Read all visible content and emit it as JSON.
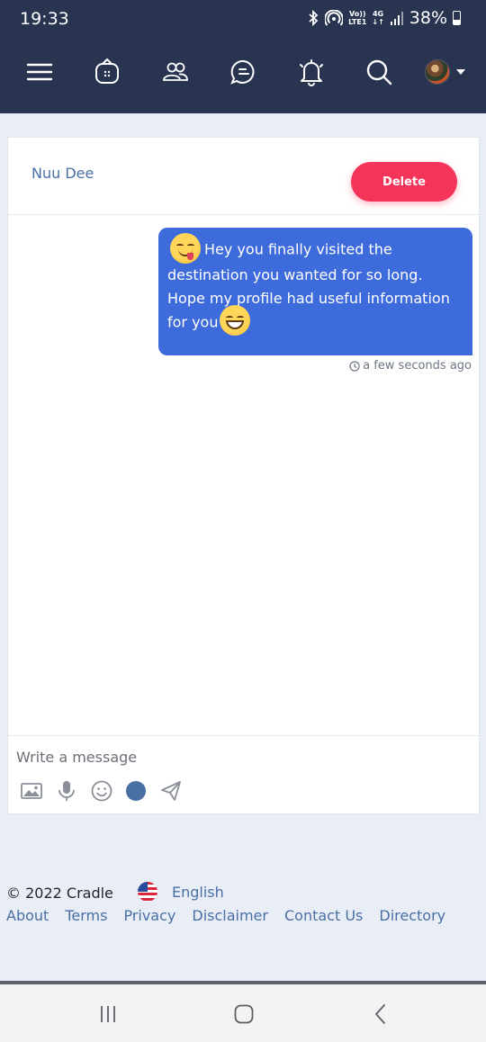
{
  "status_bar": {
    "time": "19:33",
    "volte_top": "Vo))",
    "volte_bottom": "LTE1",
    "network_top": "4G",
    "network_bottom": "↓↑",
    "battery_pct": "38%"
  },
  "nav": {
    "icons": [
      "menu-icon",
      "home-icon",
      "friends-icon",
      "messages-icon",
      "notifications-icon",
      "search-icon",
      "avatar",
      "caret-down-icon"
    ]
  },
  "chat": {
    "contact_name": "Nuu Dee",
    "delete_label": "Delete",
    "message": {
      "text_part1": "Hey you finally visited the destination you wanted for so long. Hope my profile had useful information for you",
      "timestamp": "a few seconds ago",
      "bubble_color": "#3e6bdb"
    },
    "composer": {
      "placeholder": "Write a message",
      "tools": [
        "image-icon",
        "microphone-icon",
        "emoji-icon",
        "color-picker",
        "send-icon"
      ],
      "color": "#4a6fa5"
    }
  },
  "footer": {
    "copyright": "© 2022 Cradle",
    "language": "English",
    "links": [
      "About",
      "Terms",
      "Privacy",
      "Disclaimer",
      "Contact Us",
      "Directory"
    ]
  },
  "colors": {
    "header_bg": "#283450",
    "page_bg": "#e9eef6",
    "delete_button": "#f5345a",
    "link": "#4a6fa5"
  }
}
